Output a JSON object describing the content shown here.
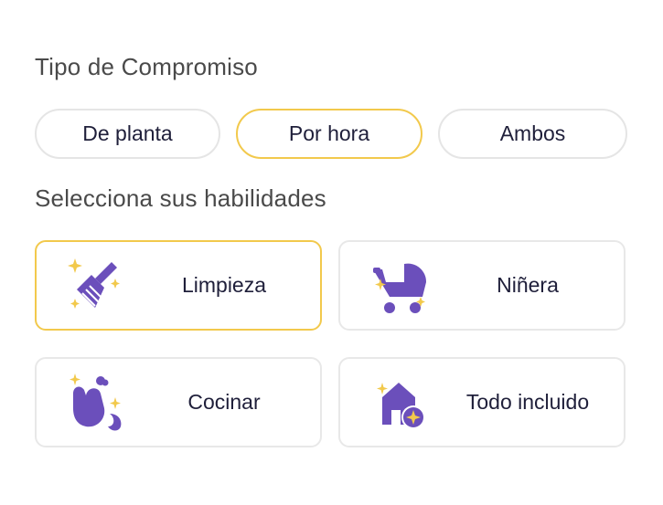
{
  "colors": {
    "accent": "#f2c94c",
    "icon_purple": "#6b4fbb",
    "sparkle": "#f2c94c",
    "border": "#e5e5e5"
  },
  "engagement": {
    "title": "Tipo de Compromiso",
    "options": [
      {
        "label": "De planta",
        "selected": false
      },
      {
        "label": "Por hora",
        "selected": true
      },
      {
        "label": "Ambos",
        "selected": false
      }
    ]
  },
  "skills": {
    "title": "Selecciona sus habilidades",
    "items": [
      {
        "label": "Limpieza",
        "icon": "broom-icon",
        "selected": true
      },
      {
        "label": "Niñera",
        "icon": "stroller-icon",
        "selected": false
      },
      {
        "label": "Cocinar",
        "icon": "oven-mitt-icon",
        "selected": false
      },
      {
        "label": "Todo incluido",
        "icon": "house-icon",
        "selected": false
      }
    ]
  }
}
